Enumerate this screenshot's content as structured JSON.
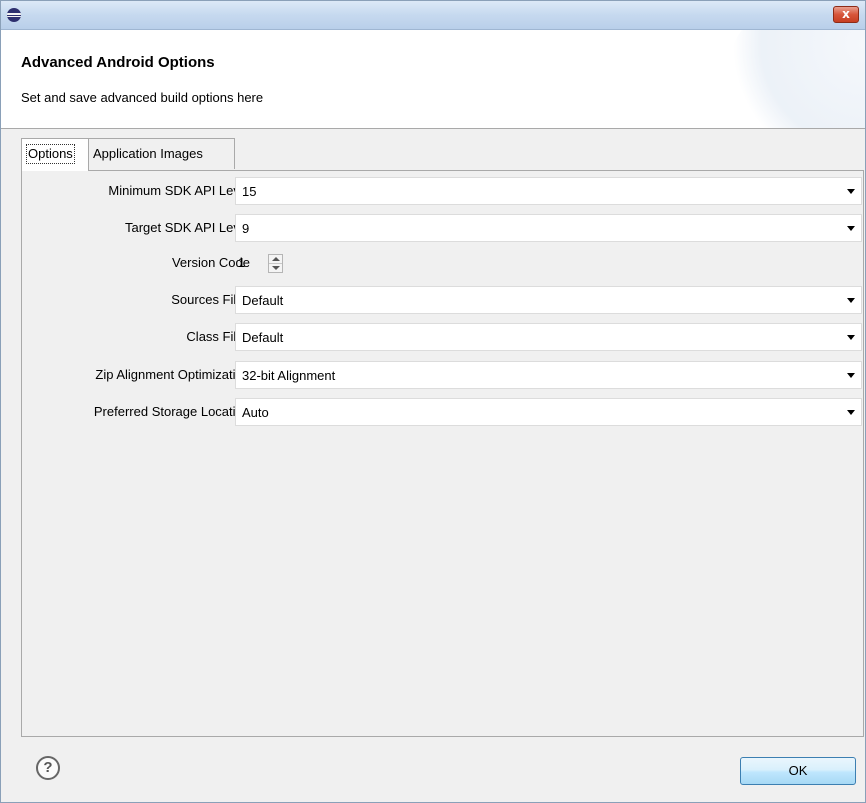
{
  "window": {
    "title": "",
    "close_label": "x",
    "icon": "eclipse-icon"
  },
  "banner": {
    "title": "Advanced Android Options",
    "subtitle": "Set and save advanced build options here"
  },
  "tabs": [
    {
      "label": "Options",
      "active": true
    },
    {
      "label": "Application Images",
      "active": false
    }
  ],
  "form": {
    "min_sdk": {
      "label": "Minimum SDK API Level",
      "value": "15"
    },
    "target_sdk": {
      "label": "Target SDK API Level",
      "value": "9"
    },
    "version_code": {
      "label": "Version Code",
      "value": "1"
    },
    "sources_files": {
      "label": "Sources Files",
      "value": "Default"
    },
    "class_files": {
      "label": "Class Files",
      "value": "Default"
    },
    "zip_alignment": {
      "label": "Zip Alignment Optimization",
      "value": "32-bit Alignment"
    },
    "storage_location": {
      "label": "Preferred Storage Location",
      "value": "Auto"
    }
  },
  "footer": {
    "help_icon": "help-icon",
    "help_glyph": "?",
    "ok_label": "OK"
  }
}
